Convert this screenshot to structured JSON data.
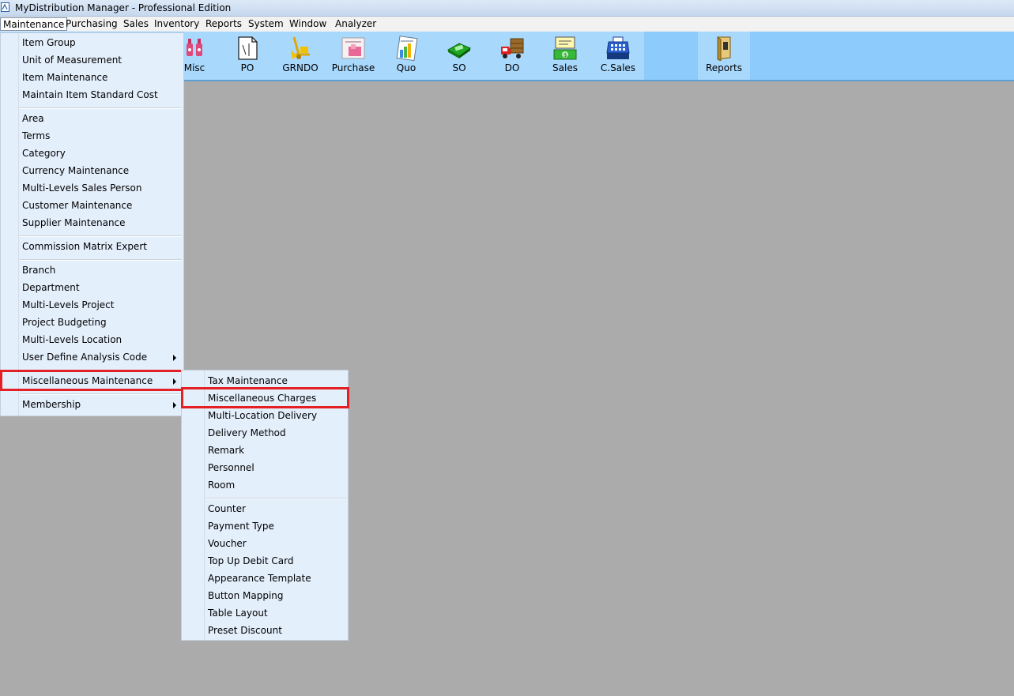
{
  "window": {
    "title": "MyDistribution Manager - Professional Edition"
  },
  "menubar": {
    "items": [
      "Maintenance",
      "Purchasing",
      "Sales",
      "Inventory",
      "Reports",
      "System",
      "Window",
      "Analyzer"
    ],
    "active": "Maintenance"
  },
  "toolbar": {
    "buttons": [
      {
        "label": "Misc",
        "icon": "misc-icon"
      },
      {
        "label": "PO",
        "icon": "document-icon"
      },
      {
        "label": "GRNDO",
        "icon": "hand-truck-icon"
      },
      {
        "label": "Purchase",
        "icon": "purchase-icon"
      },
      {
        "label": "Quo",
        "icon": "quotation-icon"
      },
      {
        "label": "SO",
        "icon": "sales-order-icon"
      },
      {
        "label": "DO",
        "icon": "delivery-truck-icon"
      },
      {
        "label": "Sales",
        "icon": "cash-invoice-icon"
      },
      {
        "label": "C.Sales",
        "icon": "cash-register-icon"
      },
      {
        "label": "Reports",
        "icon": "reports-book-icon"
      }
    ]
  },
  "maintenance_menu": {
    "groups": [
      [
        "Item Group",
        "Unit of Measurement",
        "Item Maintenance",
        "Maintain Item Standard Cost"
      ],
      [
        "Area",
        "Terms",
        "Category",
        "Currency Maintenance",
        "Multi-Levels Sales Person",
        "Customer Maintenance",
        "Supplier Maintenance"
      ],
      [
        "Commission Matrix Expert"
      ],
      [
        "Branch",
        "Department",
        "Multi-Levels Project",
        "Project Budgeting",
        "Multi-Levels Location",
        "User Define Analysis Code"
      ],
      [
        "Miscellaneous Maintenance"
      ],
      [
        "Membership"
      ]
    ],
    "highlighted": "Miscellaneous Maintenance"
  },
  "misc_submenu": {
    "groups": [
      [
        "Tax Maintenance",
        "Miscellaneous Charges",
        "Multi-Location Delivery",
        "Delivery Method",
        "Remark",
        "Personnel",
        "Room"
      ],
      [
        "Counter",
        "Payment Type",
        "Voucher",
        "Top Up Debit Card",
        "Appearance Template",
        "Button Mapping",
        "Table Layout",
        "Preset Discount"
      ]
    ],
    "highlighted": "Miscellaneous Charges"
  },
  "colors": {
    "toolbar_bg": "#8ccbfb",
    "menu_bg": "#e4effc",
    "workspace_bg": "#ababab",
    "highlight_border": "#e52025"
  }
}
